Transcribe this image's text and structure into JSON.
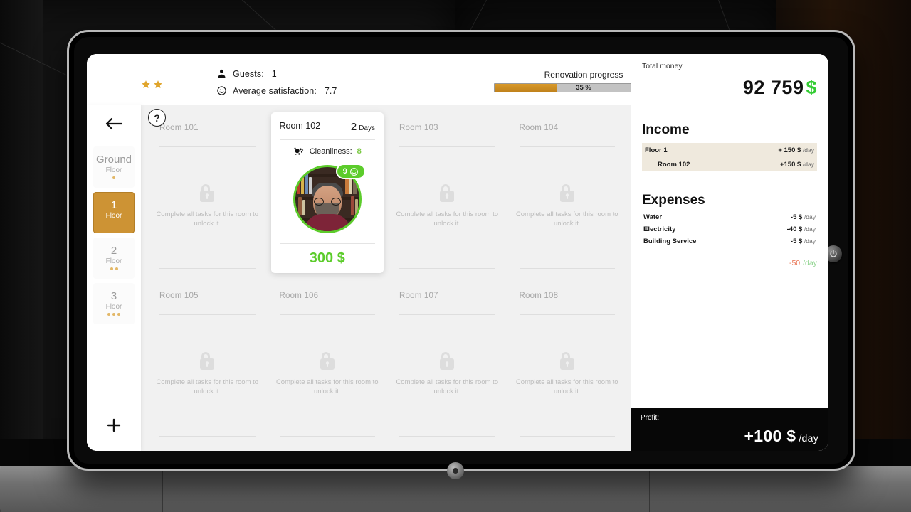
{
  "topbar": {
    "stars": 2,
    "guests_label": "Guests:",
    "guests_value": "1",
    "satisfaction_label": "Average satisfaction:",
    "satisfaction_value": "7.7",
    "renovation_label": "Renovation progress",
    "renovation_percent_text": "35 %",
    "renovation_percent": 35
  },
  "sidebar": {
    "back_icon": "arrow-left-icon",
    "add_icon": "plus-icon",
    "help_label": "?",
    "floors": [
      {
        "num": "Ground",
        "sub": "Floor",
        "dots": 1,
        "active": false
      },
      {
        "num": "1",
        "sub": "Floor",
        "dots": 0,
        "active": true
      },
      {
        "num": "2",
        "sub": "Floor",
        "dots": 2,
        "active": false
      },
      {
        "num": "3",
        "sub": "Floor",
        "dots": 3,
        "active": false
      }
    ]
  },
  "rooms": {
    "locked_text": "Complete all tasks for this room to unlock it.",
    "list": [
      {
        "name": "Room 101",
        "locked": true
      },
      {
        "name": "Room 102",
        "locked": false
      },
      {
        "name": "Room 103",
        "locked": true
      },
      {
        "name": "Room 104",
        "locked": true
      },
      {
        "name": "Room 105",
        "locked": true
      },
      {
        "name": "Room 106",
        "locked": true
      },
      {
        "name": "Room 107",
        "locked": true
      },
      {
        "name": "Room 108",
        "locked": true
      }
    ],
    "active": {
      "name": "Room 102",
      "days_num": "2",
      "days_word": "Days",
      "cleanliness_label": "Cleanliness:",
      "cleanliness_value": "8",
      "guest_badge_value": "9",
      "price": "300 $"
    }
  },
  "finance": {
    "total_label": "Total money",
    "total_value": "92 759",
    "total_currency": "$",
    "income_title": "Income",
    "income_rows": [
      {
        "name": "Floor 1",
        "value": "+ 150 $",
        "unit": "/day",
        "indent": false
      },
      {
        "name": "Room 102",
        "value": "+150 $",
        "unit": "/day",
        "indent": true
      }
    ],
    "expenses_title": "Expenses",
    "expense_rows": [
      {
        "name": "Water",
        "value": "-5 $",
        "unit": "/day"
      },
      {
        "name": "Electricity",
        "value": "-40 $",
        "unit": "/day"
      },
      {
        "name": "Building Service",
        "value": "-5 $",
        "unit": "/day"
      }
    ],
    "expense_total_value": "-50",
    "expense_total_unit": "/day",
    "profit_label": "Profit:",
    "profit_value": "+100 $",
    "profit_unit": "/day"
  },
  "colors": {
    "accent_gold": "#cd9334",
    "green": "#5ccc2b",
    "money_green": "#33cc33",
    "expense_red": "#e8704f",
    "highlight_row": "#efe9dd"
  }
}
